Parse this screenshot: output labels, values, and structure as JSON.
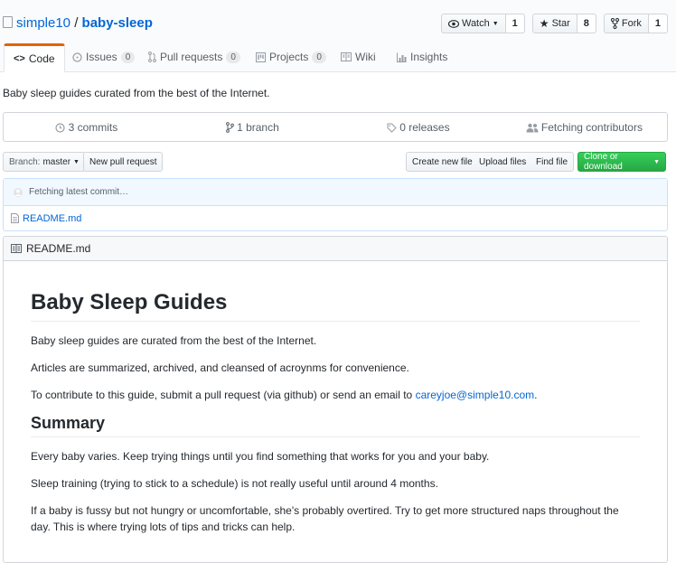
{
  "repo": {
    "owner": "simple10",
    "sep": "/",
    "name": "baby-sleep"
  },
  "actions": {
    "watch": {
      "label": "Watch",
      "count": "1"
    },
    "star": {
      "label": "Star",
      "count": "8"
    },
    "fork": {
      "label": "Fork",
      "count": "1"
    }
  },
  "tabs": [
    {
      "label": "Code"
    },
    {
      "label": "Issues",
      "count": "0"
    },
    {
      "label": "Pull requests",
      "count": "0"
    },
    {
      "label": "Projects",
      "count": "0"
    },
    {
      "label": "Wiki"
    },
    {
      "label": "Insights"
    }
  ],
  "description": "Baby sleep guides curated from the best of the Internet.",
  "summary": {
    "commits": "3 commits",
    "branches": "1 branch",
    "releases": "0 releases",
    "contributors": "Fetching contributors"
  },
  "filebar": {
    "branch_prefix": "Branch:",
    "branch": "master",
    "new_pr": "New pull request",
    "create": "Create new file",
    "upload": "Upload files",
    "find": "Find file",
    "clone": "Clone or download"
  },
  "commit": {
    "status": "Fetching latest commit…",
    "file": "README.md"
  },
  "readme": {
    "header": "README.md",
    "h1": "Baby Sleep Guides",
    "p1": "Baby sleep guides are curated from the best of the Internet.",
    "p2": "Articles are summarized, archived, and cleansed of acroynms for convenience.",
    "p3_text": "To contribute to this guide, submit a pull request (via github) or send an email to ",
    "p3_link": "careyjoe@simple10.com",
    "p3_end": ".",
    "h2": "Summary",
    "p4": "Every baby varies. Keep trying things until you find something that works for you and your baby.",
    "p5": "Sleep training (trying to stick to a schedule) is not really useful until around 4 months.",
    "p6": "If a baby is fussy but not hungry or uncomfortable, she's probably overtired. Try to get more structured naps throughout the day. This is where trying lots of tips and tricks can help."
  },
  "colors": {
    "link": "#0366d6",
    "tab_accent": "#e36209",
    "clone_green": "#28a745"
  }
}
